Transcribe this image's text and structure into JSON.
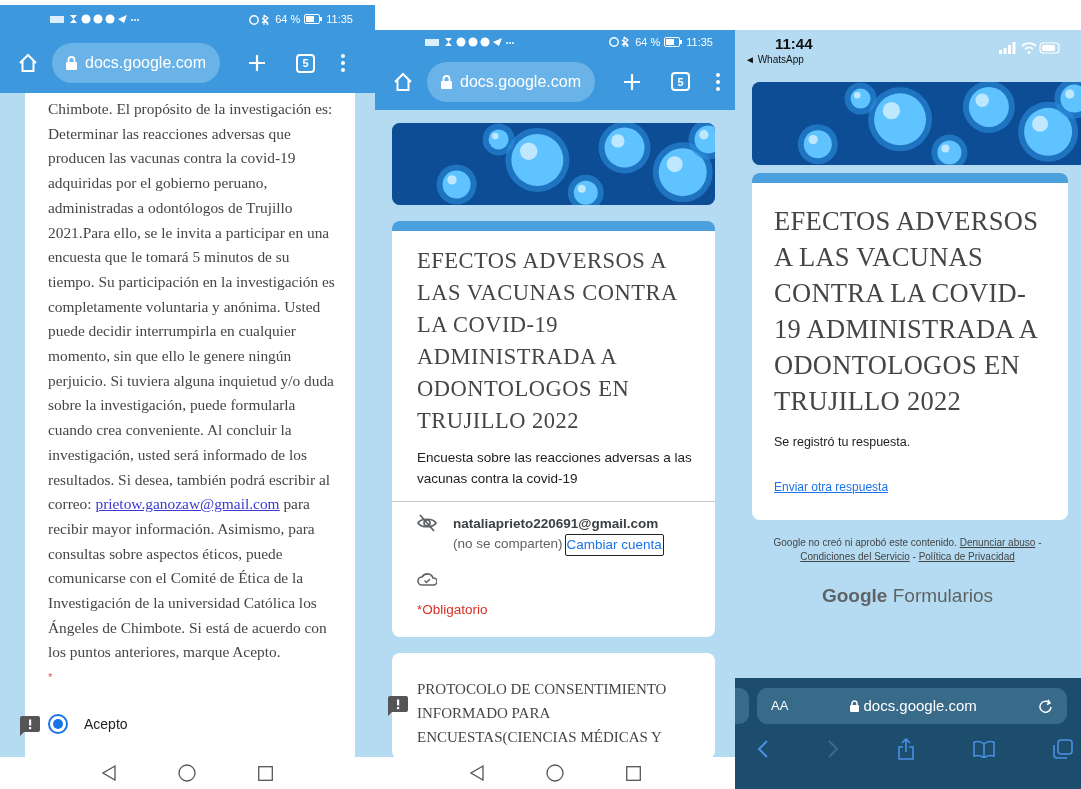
{
  "screens": [
    {
      "kind": "consent",
      "status": {
        "battery": "64 %",
        "time": "11:35"
      },
      "url": "docs.google.com",
      "tab_count": "5",
      "paragraph": "Chimbote. El propósito de la investigación es: Determinar las reacciones adversas que producen las vacunas contra la covid-19 adquiridas por el gobierno peruano, administradas a odontólogos de Trujillo 2021.Para ello, se le invita a participar en una encuesta que le tomará 5 minutos de su tiempo. Su participación en la investigación es completamente voluntaria y anónima. Usted puede decidir interrumpirla en cualquier momento, sin que ello le genere ningún perjuicio. Si tuviera alguna inquietud y/o duda sobre la investigación, puede formularla cuando crea conveniente. Al concluir la investigación, usted será informado de los resultados. Si desea, también podrá escribir al correo: ",
      "email_link": "prietow.ganozaw@gmail.com",
      "paragraph_end": " para recibir mayor información. Asimismo, para consultas sobre aspectos éticos, puede comunicarse con el Comité de Ética de la Investigación de la universidad Católica los Ángeles de Chimbote. Si está de acuerdo con los puntos anteriores, marque Acepto.",
      "required_mark": "*",
      "options": [
        {
          "label": "Acepto",
          "selected": true
        }
      ]
    },
    {
      "kind": "form",
      "status": {
        "battery": "64 %",
        "time": "11:35"
      },
      "url": "docs.google.com",
      "tab_count": "5",
      "title": "EFECTOS ADVERSOS A LAS VACUNAS CONTRA LA COVID-19 ADMINISTRADA A ODONTOLOGOS EN TRUJILLO 2022",
      "description": "Encuesta sobre las reacciones adversas a las vacunas contra la covid-19",
      "account": {
        "email": "nataliaprieto220691@gmail.com",
        "note": "(no se comparten)",
        "link": "Cambiar cuenta"
      },
      "required_note": "*Obligatorio",
      "section_title": "PROTOCOLO DE CONSENTIMIENTO INFORMADO PARA ENCUESTAS(CIENCIAS MÉDICAS Y"
    },
    {
      "kind": "confirmation",
      "status": {
        "time": "11:44",
        "back_app": "◄ WhatsApp"
      },
      "title": "EFECTOS ADVERSOS A LAS VACUNAS CONTRA LA COVID-19 ADMINISTRADA A ODONTOLOGOS EN TRUJILLO 2022",
      "message": "Se registró tu respuesta.",
      "link": "Enviar otra respuesta",
      "footer": [
        {
          "kind": "text",
          "text": "Google no creó ni aprobó este contenido."
        },
        {
          "kind": "link",
          "text": "Denunciar abuso"
        },
        {
          "kind": "text",
          "text": "-"
        },
        {
          "kind": "link",
          "text": "Condiciones del Servicio"
        },
        {
          "kind": "text",
          "text": "-"
        },
        {
          "kind": "link",
          "text": "Política de Privacidad"
        }
      ],
      "brand": {
        "strong": "Google",
        "rest": "Formularios"
      },
      "safari": {
        "text_size": "AA",
        "url": "docs.google.com"
      }
    }
  ]
}
